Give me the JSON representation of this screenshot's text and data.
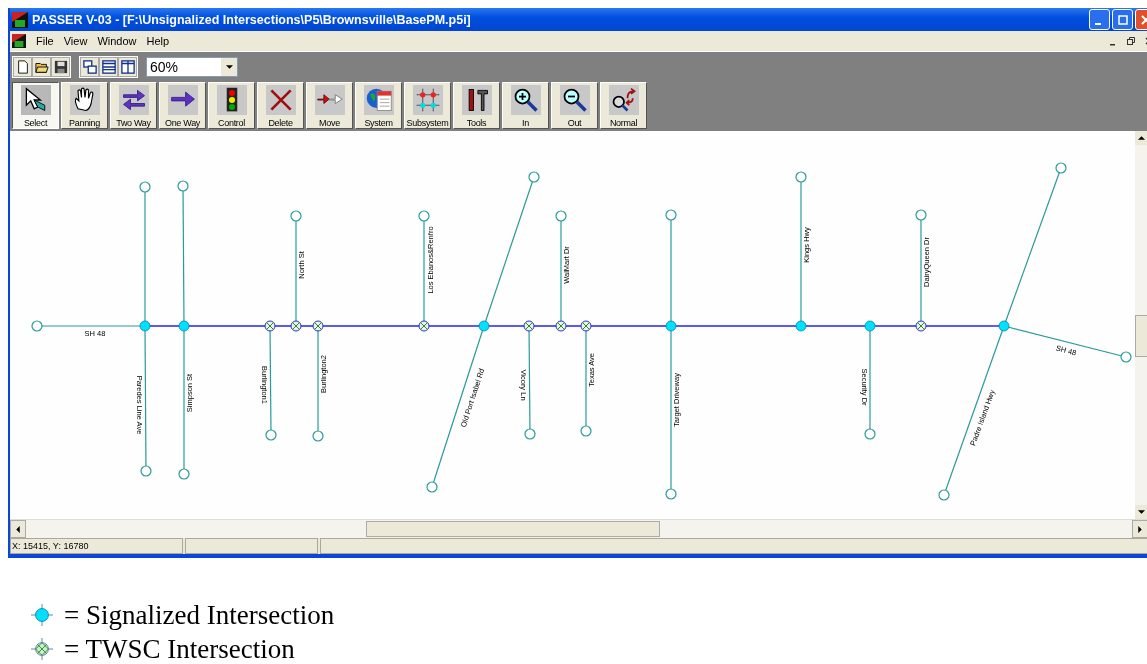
{
  "window": {
    "title": "PASSER V-03 - [F:\\Unsignalized Intersections\\P5\\Brownsville\\BasePM.p5i]"
  },
  "menu": [
    "File",
    "View",
    "Window",
    "Help"
  ],
  "zoom_select": {
    "value": "60%"
  },
  "tools": [
    {
      "label": "Select",
      "selected": true
    },
    {
      "label": "Panning",
      "selected": false
    },
    {
      "label": "Two Way",
      "selected": false
    },
    {
      "label": "One Way",
      "selected": false
    },
    {
      "label": "Control",
      "selected": false
    },
    {
      "label": "Delete",
      "selected": false
    },
    {
      "label": "Move",
      "selected": false
    },
    {
      "label": "System",
      "selected": false
    },
    {
      "label": "Subsystem",
      "selected": false
    },
    {
      "label": "Tools",
      "selected": false
    },
    {
      "label": "In",
      "selected": false
    },
    {
      "label": "Out",
      "selected": false
    },
    {
      "label": "Normal",
      "selected": false
    }
  ],
  "map": {
    "intersections": [
      {
        "kind": "signalized"
      },
      {
        "kind": "signalized"
      },
      {
        "kind": "twsc"
      },
      {
        "kind": "twsc"
      },
      {
        "kind": "twsc"
      },
      {
        "kind": "twsc"
      },
      {
        "kind": "signalized"
      },
      {
        "kind": "twsc"
      },
      {
        "kind": "twsc"
      },
      {
        "kind": "twsc"
      },
      {
        "kind": "signalized"
      },
      {
        "kind": "signalized"
      },
      {
        "kind": "signalized"
      },
      {
        "kind": "twsc"
      },
      {
        "kind": "signalized"
      }
    ],
    "streets": [
      {
        "name": "SH 48"
      },
      {
        "name": "Paredes Line Ave"
      },
      {
        "name": "Simpson St"
      },
      {
        "name": "Burlington1"
      },
      {
        "name": "North St"
      },
      {
        "name": "Burlington2"
      },
      {
        "name": "Los Ebanos&Renfro"
      },
      {
        "name": "Old Port Isabel Rd"
      },
      {
        "name": "Vicory Ln"
      },
      {
        "name": "WalMart Dr"
      },
      {
        "name": "Texas Ave"
      },
      {
        "name": "Target Driveway"
      },
      {
        "name": "Kings Hwy"
      },
      {
        "name": "Security Dr"
      },
      {
        "name": "DairyQueen Dr"
      },
      {
        "name": "Padre Island Hwy"
      },
      {
        "name": "SH 48"
      }
    ]
  },
  "status_bar": {
    "coordinates": "X: 15415, Y: 16780"
  },
  "legend": [
    {
      "kind": "signalized",
      "label": "= Signalized Intersection"
    },
    {
      "kind": "twsc",
      "label": "= TWSC Intersection"
    }
  ]
}
